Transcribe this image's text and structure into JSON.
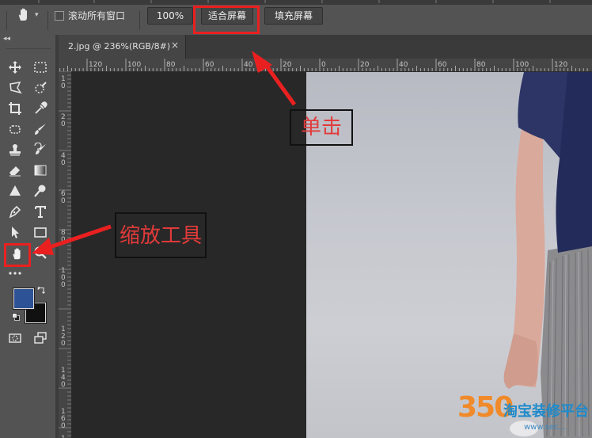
{
  "options_bar": {
    "scroll_all_windows_label": "滚动所有窗口",
    "zoom_100_label": "100%",
    "fit_screen_label": "适合屏幕",
    "fill_screen_label": "填充屏幕"
  },
  "document": {
    "tab_title": "2.jpg @ 236%(RGB/8#)",
    "close_glyph": "×"
  },
  "rulers": {
    "horizontal_ticks": [
      "120",
      "100",
      "80",
      "60",
      "40",
      "20",
      "0",
      "20",
      "40",
      "60",
      "80",
      "100",
      "120",
      "140"
    ],
    "vertical_ticks": [
      "1\n0",
      "2\n0",
      "4\n0",
      "6\n0",
      "8\n0",
      "1\n0\n0",
      "1\n2\n0",
      "1\n4\n0",
      "1\n6\n0",
      "1\n8\n0"
    ]
  },
  "annotations": {
    "click_label": "单击",
    "zoom_tool_label": "缩放工具"
  },
  "watermark": {
    "number": "350",
    "name": "淘宝装修平台",
    "url": "www.sec..."
  },
  "colors": {
    "highlight": "#ea2020",
    "arrow": "#ea2020",
    "foreground_swatch": "#2e5296",
    "background_swatch": "#111111"
  },
  "icons": [
    "hand-icon",
    "move-icon",
    "marquee-icon",
    "lasso-icon",
    "quick-select-icon",
    "crop-icon",
    "eyedropper-icon",
    "patch-icon",
    "brush-icon",
    "stamp-icon",
    "history-brush-icon",
    "eraser-icon",
    "gradient-icon",
    "sharpen-icon",
    "dodge-icon",
    "pen-icon",
    "type-icon",
    "path-select-icon",
    "rectangle-icon",
    "zoom-icon",
    "more-tools-icon",
    "swap-colors-icon",
    "default-colors-icon",
    "quick-mask-icon",
    "screen-mode-icon"
  ]
}
